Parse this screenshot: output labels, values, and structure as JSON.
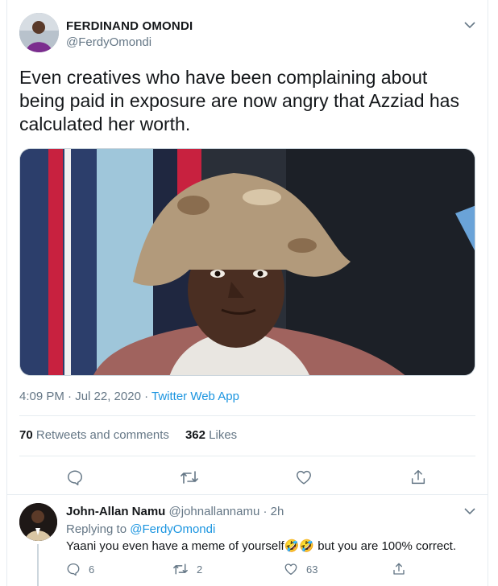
{
  "tweet": {
    "author": {
      "name": "FERDINAND OMONDI",
      "handle": "@FerdyOmondi"
    },
    "text": "Even creatives who have been complaining about being paid in exposure are now angry that Azziad has calculated her worth.",
    "timestamp": "4:09 PM · Jul 22, 2020 · ",
    "source": "Twitter Web App",
    "stats": {
      "retweets_count": "70",
      "retweets_label": "Retweets and comments",
      "likes_count": "362",
      "likes_label": "Likes"
    },
    "actions": [
      "reply-icon",
      "retweet-icon",
      "like-icon",
      "share-icon"
    ]
  },
  "reply": {
    "author": {
      "name": "John-Allan Namu",
      "handle": "@johnallannamu",
      "separator": "·",
      "time": "2h"
    },
    "replying_prefix": "Replying to ",
    "replying_to": "@FerdyOmondi",
    "text": "Yaani you even have a meme of yourself🤣🤣 but you are 100% correct.",
    "counts": {
      "replies": "6",
      "retweets": "2",
      "likes": "63"
    }
  },
  "colors": {
    "accent": "#1b95e0",
    "muted": "#657786",
    "text": "#14171a",
    "border": "#e6ecf0"
  }
}
